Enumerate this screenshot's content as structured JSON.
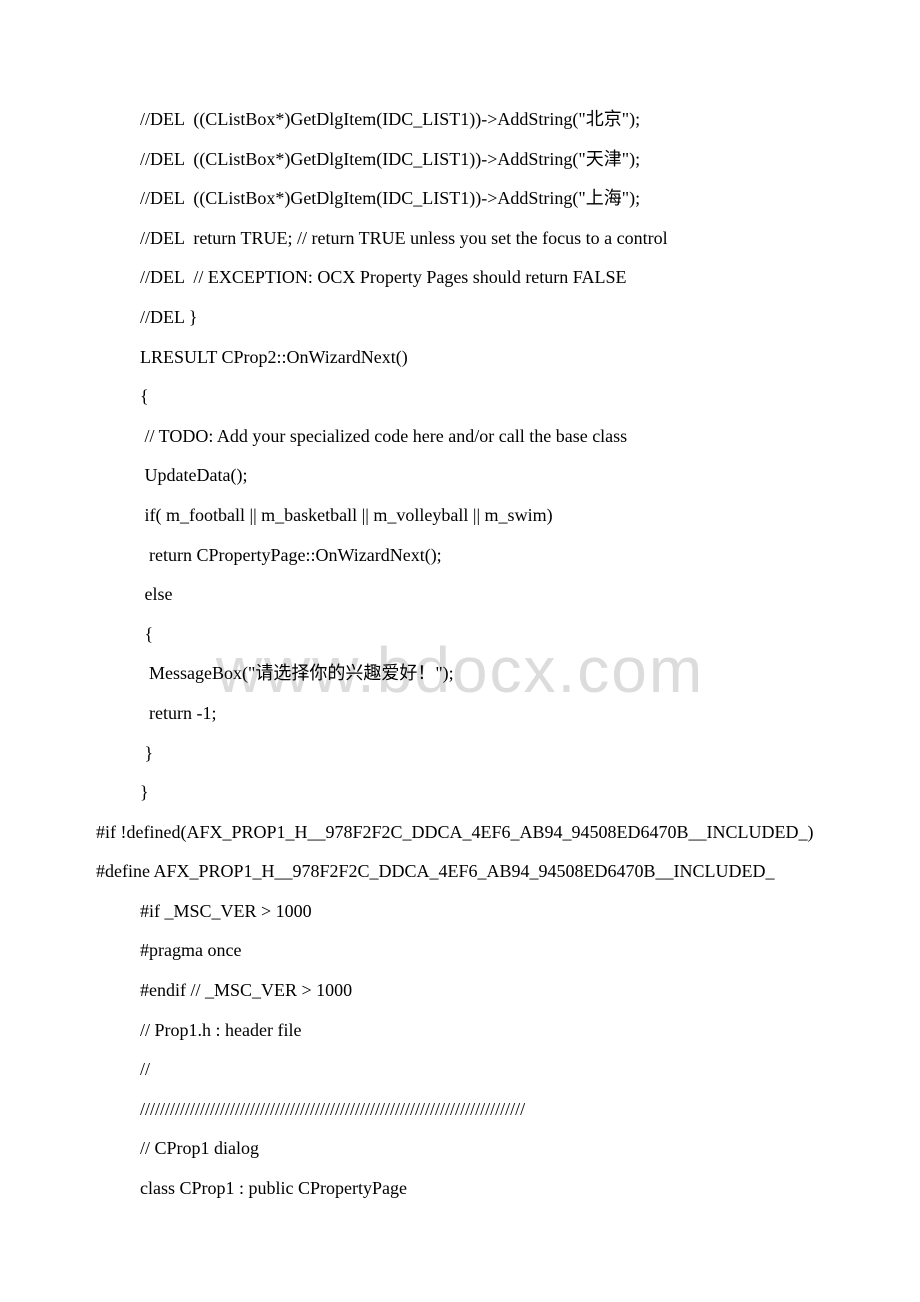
{
  "watermark": "www.bdocx.com",
  "lines": [
    {
      "text": "//DEL  ((CListBox*)GetDlgItem(IDC_LIST1))->AddString(\"北京\");",
      "indent": 1
    },
    {
      "text": "//DEL  ((CListBox*)GetDlgItem(IDC_LIST1))->AddString(\"天津\");",
      "indent": 1
    },
    {
      "text": "//DEL  ((CListBox*)GetDlgItem(IDC_LIST1))->AddString(\"上海\");",
      "indent": 1
    },
    {
      "text": "//DEL  return TRUE; // return TRUE unless you set the focus to a control",
      "indent": 1
    },
    {
      "text": "//DEL  // EXCEPTION: OCX Property Pages should return FALSE",
      "indent": 1
    },
    {
      "text": "//DEL }",
      "indent": 1
    },
    {
      "text": "LRESULT CProp2::OnWizardNext()",
      "indent": 1
    },
    {
      "text": "{",
      "indent": 1
    },
    {
      "text": " // TODO: Add your specialized code here and/or call the base class",
      "indent": 1
    },
    {
      "text": " UpdateData();",
      "indent": 1
    },
    {
      "text": " if( m_football || m_basketball || m_volleyball || m_swim)",
      "indent": 1
    },
    {
      "text": "  return CPropertyPage::OnWizardNext();",
      "indent": 1
    },
    {
      "text": " else",
      "indent": 1
    },
    {
      "text": " {",
      "indent": 1
    },
    {
      "text": "  MessageBox(\"请选择你的兴趣爱好！\");",
      "indent": 1
    },
    {
      "text": "  return -1;",
      "indent": 1
    },
    {
      "text": " }",
      "indent": 1
    },
    {
      "text": "}",
      "indent": 1
    },
    {
      "text": "　　#if !defined(AFX_PROP1_H__978F2F2C_DDCA_4EF6_AB94_94508ED6470B__INCLUDED_)",
      "indent": 0
    },
    {
      "text": "　　#define AFX_PROP1_H__978F2F2C_DDCA_4EF6_AB94_94508ED6470B__INCLUDED_",
      "indent": 0
    },
    {
      "text": "#if _MSC_VER > 1000",
      "indent": 1
    },
    {
      "text": "#pragma once",
      "indent": 1
    },
    {
      "text": "#endif // _MSC_VER > 1000",
      "indent": 1
    },
    {
      "text": "// Prop1.h : header file",
      "indent": 1
    },
    {
      "text": "//",
      "indent": 1
    },
    {
      "text": "/////////////////////////////////////////////////////////////////////////////",
      "indent": 1
    },
    {
      "text": "// CProp1 dialog",
      "indent": 1
    },
    {
      "text": "class CProp1 : public CPropertyPage",
      "indent": 1
    }
  ]
}
